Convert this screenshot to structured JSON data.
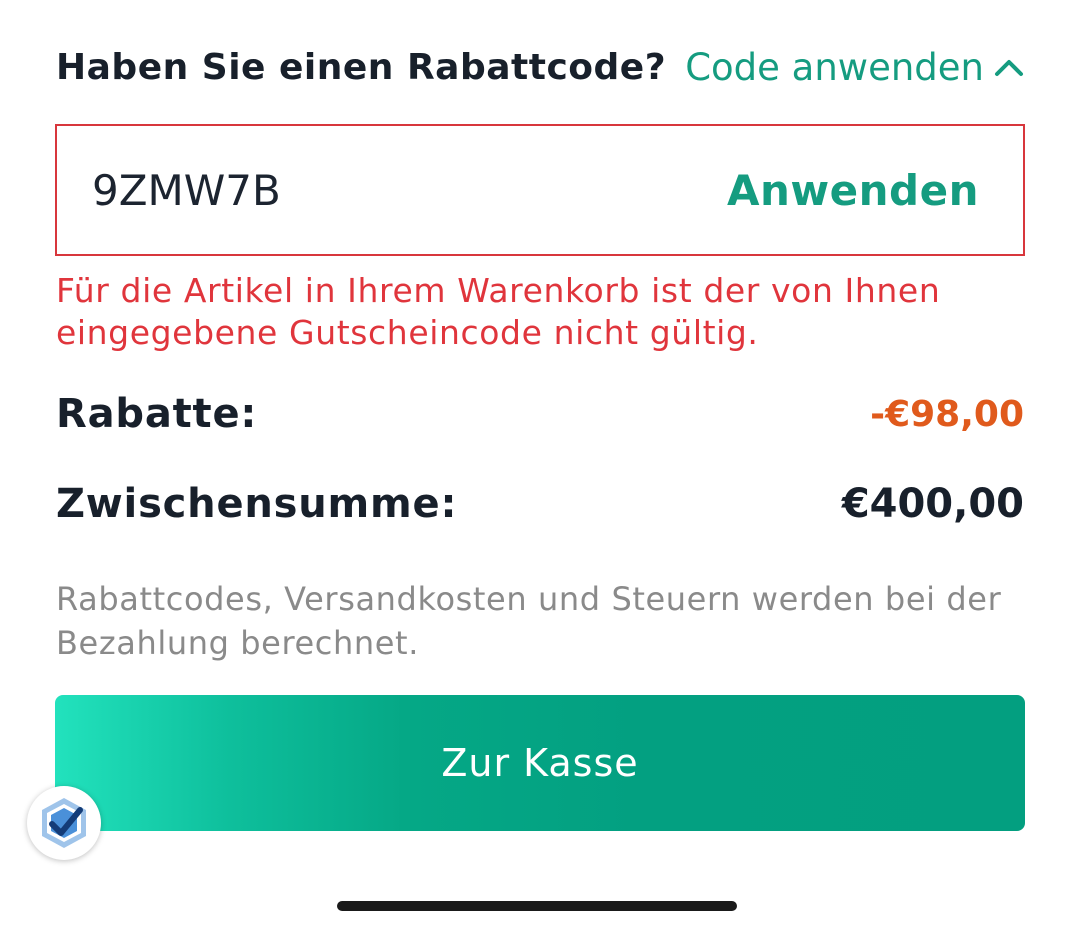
{
  "promo": {
    "question": "Haben Sie einen Rabattcode?",
    "toggle_label": "Code anwenden",
    "code_value": "9ZMW7B",
    "apply_label": "Anwenden",
    "error": "Für die Artikel in Ihrem Warenkorb ist der von Ihnen eingegebene Gutscheincode nicht gültig."
  },
  "summary": {
    "discount_label": "Rabatte:",
    "discount_value": "-€98,00",
    "subtotal_label": "Zwischensumme:",
    "subtotal_value": "€400,00"
  },
  "note": "Rabattcodes, Versandkosten und Steuern werden bei der Bezahlung berechnet.",
  "checkout_label": "Zur Kasse",
  "icons": {
    "toggle": "chevron-up-icon",
    "badge": "verified-check-icon"
  },
  "colors": {
    "accent": "#159c80",
    "error": "#e0353c",
    "discount": "#e05a1c",
    "text": "#18202b",
    "muted": "#8a8a8a"
  }
}
